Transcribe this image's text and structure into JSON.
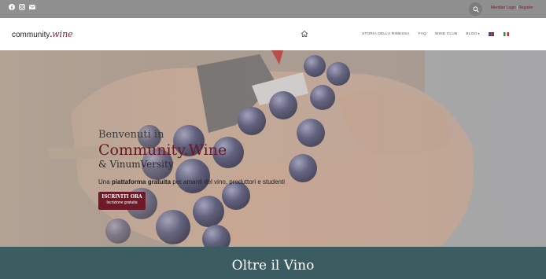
{
  "topbar": {
    "social_icons": [
      "facebook-icon",
      "instagram-icon",
      "email-icon"
    ],
    "search_icon": "search-icon",
    "member_login": "Member Login",
    "separator": "|",
    "register": "Register"
  },
  "header": {
    "logo": {
      "part1": "community",
      "dot": ".",
      "part2": "wine"
    },
    "home_icon": "home-icon",
    "nav": [
      {
        "label": "STORIA DELLA RIMESSA"
      },
      {
        "label": "FAQ"
      },
      {
        "label": "WINE CLUB"
      },
      {
        "label": "BLOG"
      }
    ],
    "blog_chevron": "▾",
    "flags": [
      "uk-flag-icon",
      "italy-flag-icon"
    ]
  },
  "hero": {
    "welcome": "Benvenuti in",
    "brand": "Community.Wine",
    "sub": "&  VinumVersity",
    "tagline_pre": "Una ",
    "tagline_bold": "piattaforma gratuita",
    "tagline_post": " per amanti del vino, produttori e studenti",
    "cta_line1": "ISCRIVITI ORA",
    "cta_line2": "Iscrizione gratuita"
  },
  "band": {
    "title": "Oltre il Vino"
  },
  "colors": {
    "accent": "#6d1a28",
    "topbar": "#8f8f8f",
    "band": "#3b5d62"
  }
}
